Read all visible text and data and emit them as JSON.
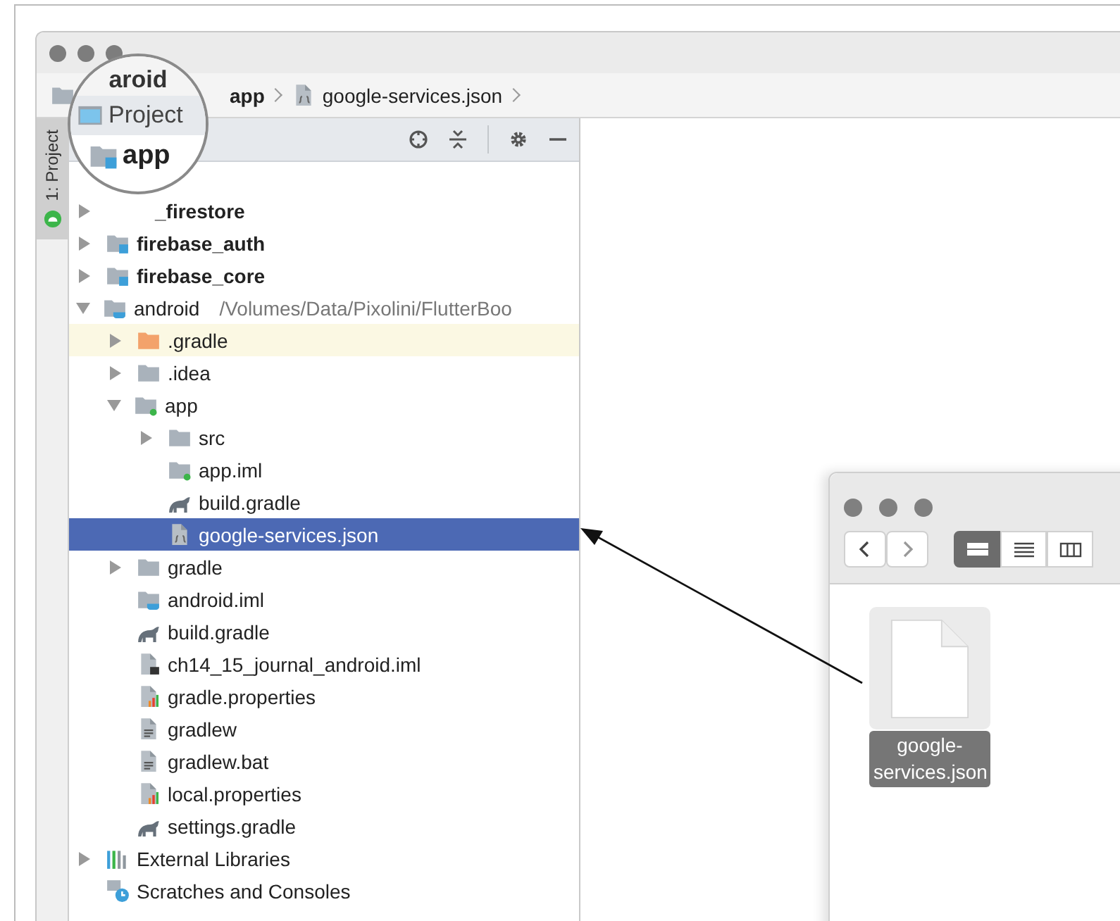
{
  "breadcrumb": [
    {
      "label": "app"
    },
    {
      "label": "google-services.json",
      "kind": "json"
    }
  ],
  "side_tab": {
    "label": "1: Project",
    "selected": true
  },
  "magnifier": {
    "crumb": "aroid",
    "panel_title": "Project",
    "root": "app"
  },
  "tree": [
    {
      "label": "_firestore",
      "bold": true,
      "expanded": false,
      "selected": false,
      "highlighted": false
    },
    {
      "label": "firebase_auth",
      "kind": "module",
      "bold": true,
      "expanded": false,
      "selected": false,
      "highlighted": false
    },
    {
      "label": "firebase_core",
      "kind": "module",
      "bold": true,
      "expanded": false,
      "selected": false,
      "highlighted": false
    },
    {
      "label": "android",
      "kind": "android-module",
      "detail": "/Volumes/Data/Pixolini/FlutterBoo",
      "expanded": true,
      "selected": false,
      "highlighted": false,
      "children": [
        {
          "label": ".gradle",
          "kind": "excluded-folder",
          "expanded": false,
          "selected": false,
          "highlighted": true
        },
        {
          "label": ".idea",
          "kind": "folder",
          "expanded": false,
          "selected": false,
          "highlighted": false
        },
        {
          "label": "app",
          "kind": "app-module",
          "expanded": true,
          "selected": false,
          "highlighted": false,
          "children": [
            {
              "label": "src",
              "kind": "folder",
              "expanded": false,
              "selected": false,
              "highlighted": false
            },
            {
              "label": "app.iml",
              "kind": "app-iml",
              "selected": false,
              "highlighted": false
            },
            {
              "label": "build.gradle",
              "kind": "gradle",
              "selected": false,
              "highlighted": false
            },
            {
              "label": "google-services.json",
              "kind": "json",
              "selected": true,
              "highlighted": false
            }
          ]
        },
        {
          "label": "gradle",
          "kind": "folder",
          "expanded": false,
          "selected": false,
          "highlighted": false
        },
        {
          "label": "android.iml",
          "kind": "android-iml",
          "selected": false,
          "highlighted": false
        },
        {
          "label": "build.gradle",
          "kind": "gradle",
          "selected": false,
          "highlighted": false
        },
        {
          "label": "ch14_15_journal_android.iml",
          "kind": "iml",
          "selected": false,
          "highlighted": false
        },
        {
          "label": "gradle.properties",
          "kind": "properties",
          "selected": false,
          "highlighted": false
        },
        {
          "label": "gradlew",
          "kind": "text",
          "selected": false,
          "highlighted": false
        },
        {
          "label": "gradlew.bat",
          "kind": "text",
          "selected": false,
          "highlighted": false
        },
        {
          "label": "local.properties",
          "kind": "properties",
          "selected": false,
          "highlighted": false
        },
        {
          "label": "settings.gradle",
          "kind": "gradle",
          "selected": false,
          "highlighted": false
        }
      ]
    },
    {
      "label": "External Libraries",
      "kind": "libraries",
      "expanded": false,
      "selected": false,
      "highlighted": false
    },
    {
      "label": "Scratches and Consoles",
      "kind": "scratches",
      "selected": false,
      "highlighted": false
    }
  ],
  "finder": {
    "views": [
      {
        "kind": "icons",
        "selected": true
      },
      {
        "kind": "list",
        "selected": false
      },
      {
        "kind": "columns",
        "selected": false
      }
    ],
    "file": {
      "name": "google-services.json",
      "selected": true
    }
  }
}
